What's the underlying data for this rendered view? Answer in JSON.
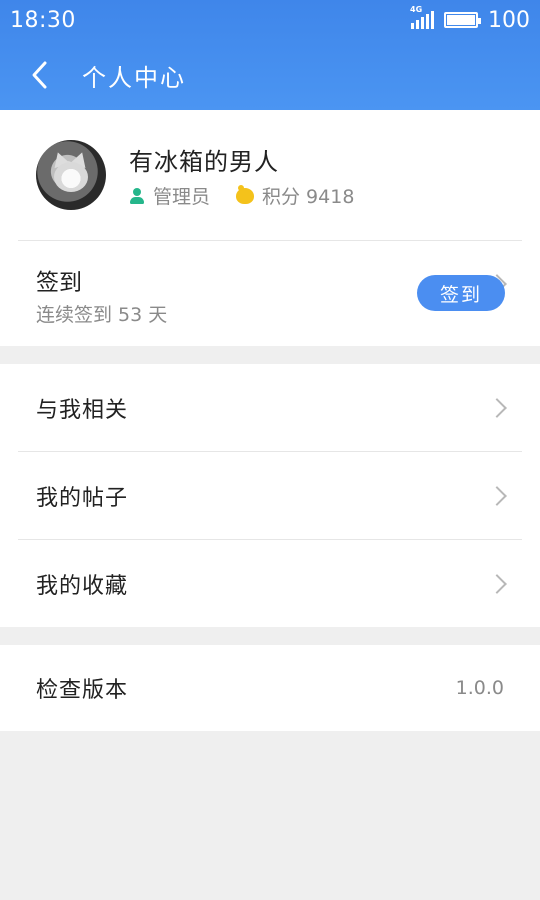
{
  "status_bar": {
    "time": "18:30",
    "network_label": "4G",
    "battery_level": "100"
  },
  "navbar": {
    "title": "个人中心"
  },
  "profile": {
    "username": "有冰箱的男人",
    "role": "管理员",
    "points_label": "积分 9418"
  },
  "signin": {
    "title": "签到",
    "subtitle": "连续签到 53 天",
    "button_label": "签到"
  },
  "menu": {
    "items": [
      {
        "label": "与我相关"
      },
      {
        "label": "我的帖子"
      },
      {
        "label": "我的收藏"
      }
    ]
  },
  "version": {
    "label": "检查版本",
    "value": "1.0.0"
  },
  "colors": {
    "header_blue": "#3f86ea",
    "accent_blue": "#4b8ef1",
    "role_green": "#25b68b",
    "coin_yellow": "#f4c21b"
  },
  "icons": [
    "back-arrow-icon",
    "signal-icon",
    "battery-icon",
    "person-icon",
    "coin-icon",
    "chevron-right-icon"
  ]
}
